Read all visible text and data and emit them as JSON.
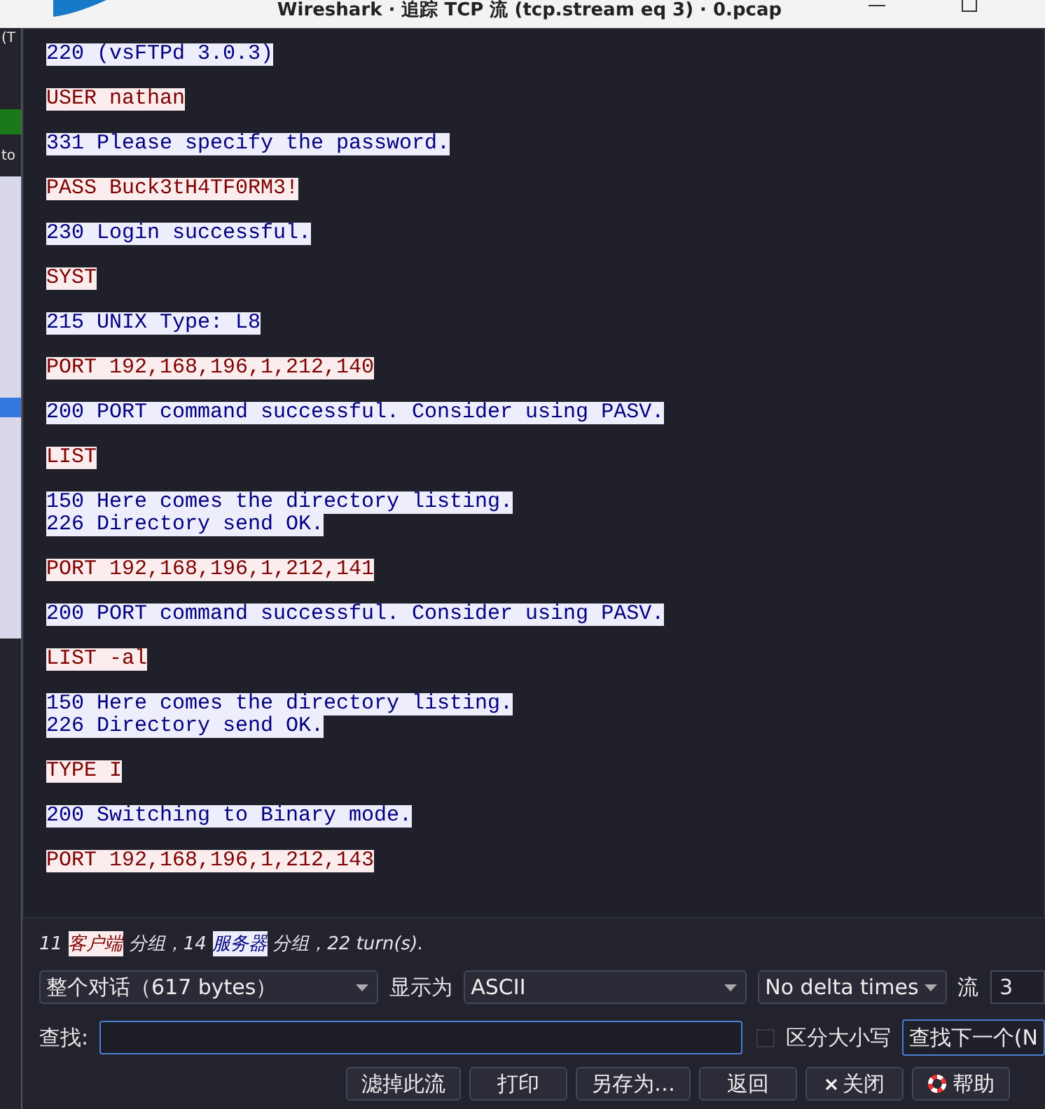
{
  "window": {
    "title": "Wireshark · 追踪 TCP 流 (tcp.stream eq 3) · 0.pcap"
  },
  "background_window": {
    "texts": [
      "(T",
      "to"
    ]
  },
  "stream": [
    {
      "kind": "server",
      "lines": [
        "220 (vsFTPd 3.0.3)"
      ]
    },
    {
      "kind": "client",
      "lines": [
        "USER nathan"
      ]
    },
    {
      "kind": "server",
      "lines": [
        "331 Please specify the password."
      ]
    },
    {
      "kind": "client",
      "lines": [
        "PASS Buck3tH4TF0RM3!"
      ]
    },
    {
      "kind": "server",
      "lines": [
        "230 Login successful."
      ]
    },
    {
      "kind": "client",
      "lines": [
        "SYST"
      ]
    },
    {
      "kind": "server",
      "lines": [
        "215 UNIX Type: L8"
      ]
    },
    {
      "kind": "client",
      "lines": [
        "PORT 192,168,196,1,212,140"
      ]
    },
    {
      "kind": "server",
      "lines": [
        "200 PORT command successful. Consider using PASV."
      ]
    },
    {
      "kind": "client",
      "lines": [
        "LIST"
      ]
    },
    {
      "kind": "server",
      "lines": [
        "150 Here comes the directory listing.",
        "226 Directory send OK."
      ]
    },
    {
      "kind": "client",
      "lines": [
        "PORT 192,168,196,1,212,141"
      ]
    },
    {
      "kind": "server",
      "lines": [
        "200 PORT command successful. Consider using PASV."
      ]
    },
    {
      "kind": "client",
      "lines": [
        "LIST -al"
      ]
    },
    {
      "kind": "server",
      "lines": [
        "150 Here comes the directory listing.",
        "226 Directory send OK."
      ]
    },
    {
      "kind": "client",
      "lines": [
        "TYPE I"
      ]
    },
    {
      "kind": "server",
      "lines": [
        "200 Switching to Binary mode."
      ]
    },
    {
      "kind": "client",
      "lines": [
        "PORT 192,168,196,1,212,143"
      ]
    }
  ],
  "summary": [
    {
      "kind": "text",
      "text": "11 "
    },
    {
      "kind": "client",
      "text": "客户端"
    },
    {
      "kind": "text",
      "text": " 分组，14 "
    },
    {
      "kind": "server",
      "text": "服务器"
    },
    {
      "kind": "text",
      "text": " 分组，22 turn(s)."
    }
  ],
  "conversation_select": {
    "value": "整个对话（617 bytes）"
  },
  "show_as": {
    "label": "显示为",
    "value": "ASCII"
  },
  "delta_select": {
    "value": "No delta times"
  },
  "stream_number": {
    "label": "流",
    "value": "3"
  },
  "find": {
    "label": "查找:"
  },
  "case_sensitive": {
    "label": "区分大小写",
    "checked": false
  },
  "find_next_button": "查找下一个(N",
  "buttons": [
    {
      "kind": "plain",
      "label": "滤掉此流"
    },
    {
      "kind": "plain",
      "label": "打印"
    },
    {
      "kind": "plain",
      "label": "另存为…"
    },
    {
      "kind": "plain",
      "label": "返回"
    },
    {
      "kind": "close",
      "label": "关闭"
    },
    {
      "kind": "help",
      "label": "帮助"
    }
  ]
}
